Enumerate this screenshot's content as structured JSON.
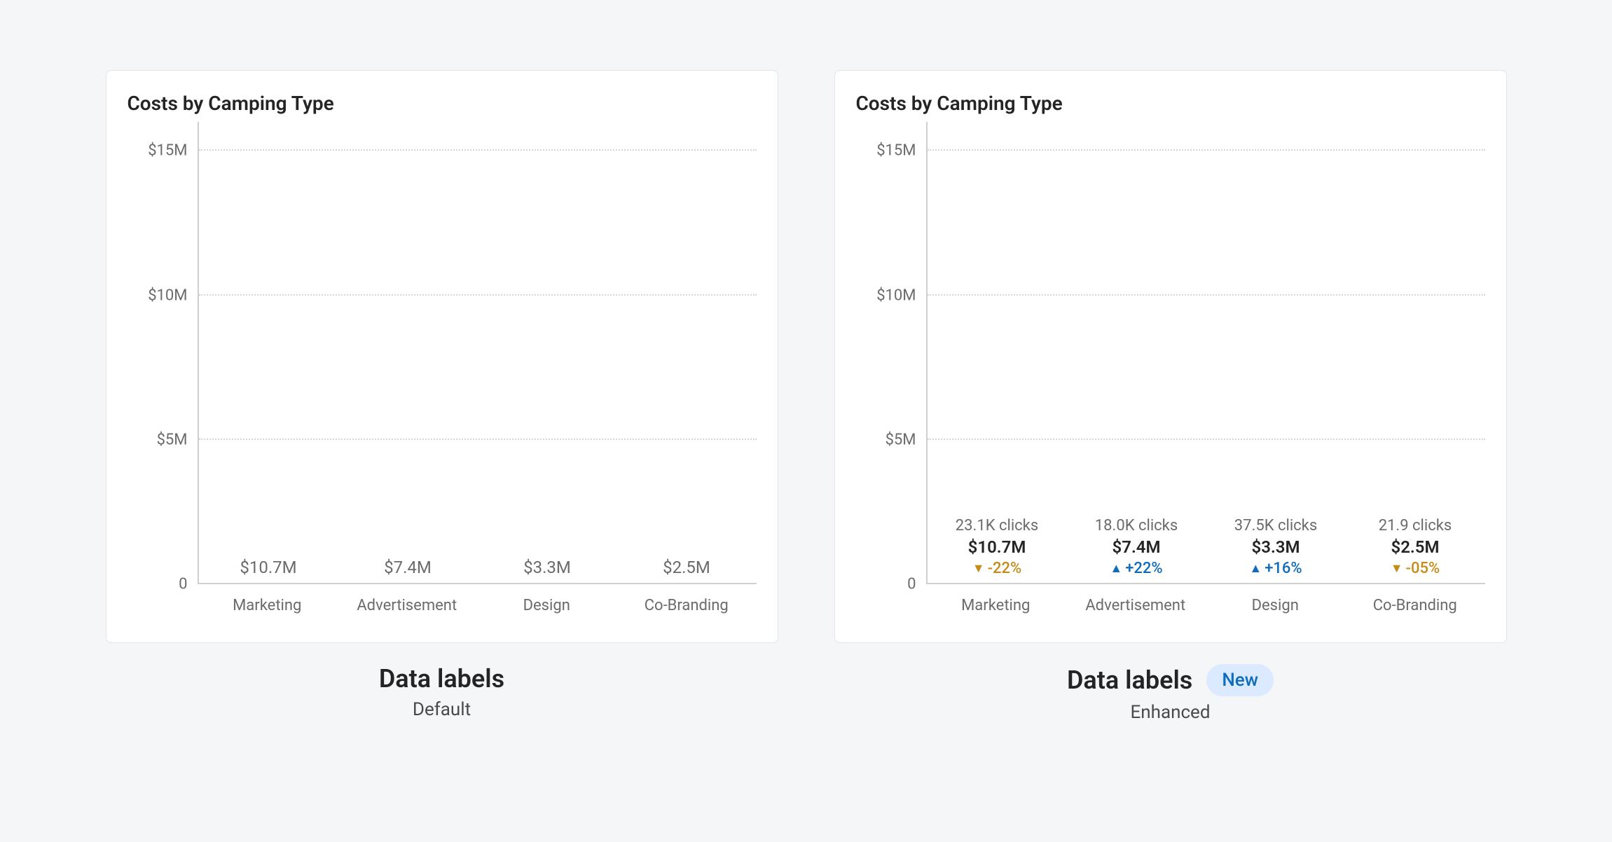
{
  "chart_data": [
    {
      "type": "bar",
      "title": "Costs by Camping Type",
      "categories": [
        "Marketing",
        "Advertisement",
        "Design",
        "Co-Branding"
      ],
      "values": [
        10.7,
        7.4,
        3.3,
        2.5
      ],
      "value_labels": [
        "$10.7M",
        "$7.4M",
        "$3.3M",
        "$2.5M"
      ],
      "ylabel": "",
      "ylim": [
        0,
        16
      ],
      "y_ticks": [
        0,
        5,
        10,
        15
      ],
      "y_tick_labels": [
        "0",
        "$5M",
        "$10M",
        "$15M"
      ]
    },
    {
      "type": "bar",
      "title": "Costs by Camping Type",
      "categories": [
        "Marketing",
        "Advertisement",
        "Design",
        "Co-Branding"
      ],
      "values": [
        10.7,
        7.4,
        3.3,
        2.5
      ],
      "value_labels": [
        "$10.7M",
        "$7.4M",
        "$3.3M",
        "$2.5M"
      ],
      "ylabel": "",
      "ylim": [
        0,
        16
      ],
      "y_ticks": [
        0,
        5,
        10,
        15
      ],
      "y_tick_labels": [
        "0",
        "$5M",
        "$10M",
        "$15M"
      ],
      "extra_labels": {
        "clicks": [
          "23.1K clicks",
          "18.0K clicks",
          "37.5K clicks",
          "21.9 clicks"
        ],
        "delta_text": [
          "-22%",
          "+22%",
          "+16%",
          "-05%"
        ],
        "delta_dir": [
          "down",
          "up",
          "up",
          "down"
        ]
      }
    }
  ],
  "captions": {
    "left": {
      "title": "Data labels",
      "sub": "Default"
    },
    "right": {
      "title": "Data labels",
      "sub": "Enhanced",
      "badge": "New"
    }
  }
}
